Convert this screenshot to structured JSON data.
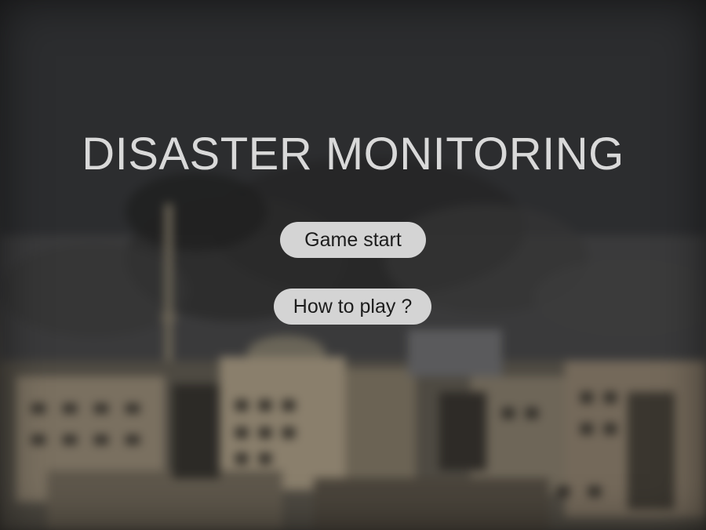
{
  "title": "DISASTER MONITORING",
  "menu": {
    "start_label": "Game start",
    "howto_label": "How to play ?"
  },
  "background": {
    "description_icon": "destroyed-city-skyline",
    "sky_color": "#2b2c2e",
    "smoke_color": "#3a3a3a",
    "building_color": "#6a6153"
  },
  "colors": {
    "title_text": "#d9d9d9",
    "button_bg": "#d4d4d4",
    "button_text": "#1c1c1c"
  }
}
